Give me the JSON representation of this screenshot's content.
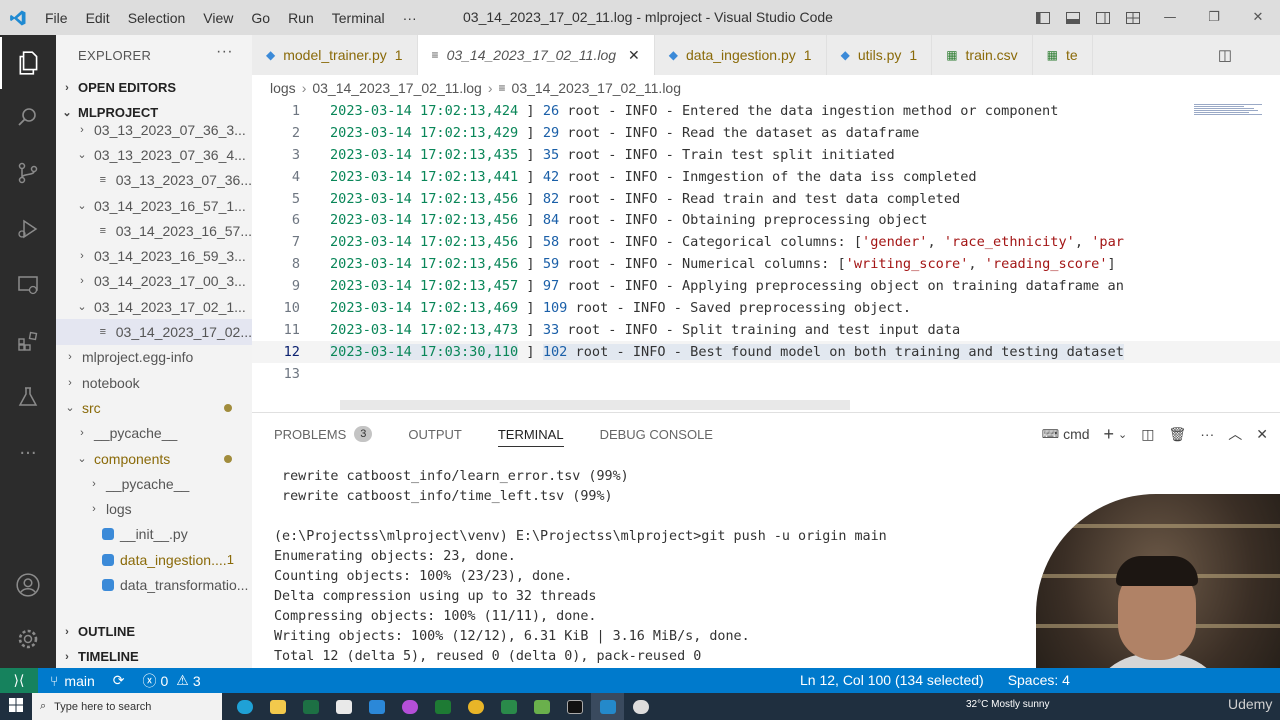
{
  "titlebar": {
    "menu": [
      "File",
      "Edit",
      "Selection",
      "View",
      "Go",
      "Run",
      "Terminal",
      "···"
    ],
    "window_title": "03_14_2023_17_02_11.log - mlproject - Visual Studio Code"
  },
  "sidebar": {
    "header": "EXPLORER",
    "more": "···",
    "open_editors": "OPEN EDITORS",
    "project": "MLPROJECT",
    "tree": [
      {
        "label": "03_13_2023_07_36_3...",
        "type": "folder",
        "open": false,
        "indent": 1
      },
      {
        "label": "03_13_2023_07_36_4...",
        "type": "folder",
        "open": true,
        "indent": 1
      },
      {
        "label": "03_13_2023_07_36...",
        "type": "file",
        "indent": 2
      },
      {
        "label": "03_14_2023_16_57_1...",
        "type": "folder",
        "open": true,
        "indent": 1
      },
      {
        "label": "03_14_2023_16_57...",
        "type": "file",
        "indent": 2
      },
      {
        "label": "03_14_2023_16_59_3...",
        "type": "folder",
        "open": false,
        "indent": 1
      },
      {
        "label": "03_14_2023_17_00_3...",
        "type": "folder",
        "open": false,
        "indent": 1
      },
      {
        "label": "03_14_2023_17_02_1...",
        "type": "folder",
        "open": true,
        "indent": 1
      },
      {
        "label": "03_14_2023_17_02...",
        "type": "file",
        "indent": 2,
        "selected": true
      },
      {
        "label": "mlproject.egg-info",
        "type": "folder",
        "open": false,
        "indent": 0
      },
      {
        "label": "notebook",
        "type": "folder",
        "open": false,
        "indent": 0
      },
      {
        "label": "src",
        "type": "folder",
        "open": true,
        "indent": 0,
        "modified": true,
        "dot": true
      },
      {
        "label": "__pycache__",
        "type": "folder",
        "open": false,
        "indent": 1
      },
      {
        "label": "components",
        "type": "folder",
        "open": true,
        "indent": 1,
        "modified": true,
        "dot": true
      },
      {
        "label": "__pycache__",
        "type": "folder",
        "open": false,
        "indent": 2
      },
      {
        "label": "logs",
        "type": "folder",
        "open": false,
        "indent": 2
      },
      {
        "label": "__init__.py",
        "type": "py",
        "indent": 2
      },
      {
        "label": "data_ingestion....",
        "type": "py",
        "indent": 2,
        "modified": true,
        "badge": "1"
      },
      {
        "label": "data_transformatio...",
        "type": "py",
        "indent": 2
      }
    ],
    "outline": "OUTLINE",
    "timeline": "TIMELINE"
  },
  "tabs": [
    {
      "label": "model_trainer.py",
      "badge": "1",
      "icon": "python-icon"
    },
    {
      "label": "03_14_2023_17_02_11.log",
      "badge": "",
      "icon": "lines-icon",
      "active": true
    },
    {
      "label": "data_ingestion.py",
      "badge": "1",
      "icon": "python-icon"
    },
    {
      "label": "utils.py",
      "badge": "1",
      "icon": "python-icon"
    },
    {
      "label": "train.csv",
      "badge": "",
      "icon": "table-icon"
    },
    {
      "label": "te",
      "badge": "",
      "icon": "table-icon"
    }
  ],
  "breadcrumb": [
    "logs",
    "03_14_2023_17_02_11.log",
    "03_14_2023_17_02_11.log"
  ],
  "editor": {
    "lines": [
      {
        "n": "1",
        "ts": "2023-03-14 17:02:13,424",
        "num": "26",
        "msg": " root - INFO - Entered the data ingestion method or component"
      },
      {
        "n": "2",
        "ts": "2023-03-14 17:02:13,429",
        "num": "29",
        "msg": " root - INFO - Read the dataset as dataframe"
      },
      {
        "n": "3",
        "ts": "2023-03-14 17:02:13,435",
        "num": "35",
        "msg": " root - INFO - Train test split initiated"
      },
      {
        "n": "4",
        "ts": "2023-03-14 17:02:13,441",
        "num": "42",
        "msg": " root - INFO - Inmgestion of the data iss completed"
      },
      {
        "n": "5",
        "ts": "2023-03-14 17:02:13,456",
        "num": "82",
        "msg": " root - INFO - Read train and test data completed"
      },
      {
        "n": "6",
        "ts": "2023-03-14 17:02:13,456",
        "num": "84",
        "msg": " root - INFO - Obtaining preprocessing object"
      },
      {
        "n": "7",
        "ts": "2023-03-14 17:02:13,456",
        "num": "58",
        "msg": " root - INFO - Categorical columns: [",
        "strs": [
          "'gender'",
          ", ",
          "'race_ethnicity'",
          ", ",
          "'par"
        ]
      },
      {
        "n": "8",
        "ts": "2023-03-14 17:02:13,456",
        "num": "59",
        "msg": " root - INFO - Numerical columns: [",
        "strs": [
          "'writing_score'",
          ", ",
          "'reading_score'",
          "]"
        ]
      },
      {
        "n": "9",
        "ts": "2023-03-14 17:02:13,457",
        "num": "97",
        "msg": " root - INFO - Applying preprocessing object on training dataframe an"
      },
      {
        "n": "10",
        "ts": "2023-03-14 17:02:13,469",
        "num": "109",
        "msg": " root - INFO - Saved preprocessing object."
      },
      {
        "n": "11",
        "ts": "2023-03-14 17:02:13,473",
        "num": "33",
        "msg": " root - INFO - Split training and test input data"
      },
      {
        "n": "12",
        "ts": "2023-03-14 17:03:30,110",
        "num": "102",
        "msg": " root - INFO - Best found model on both training and testing dataset",
        "current": true
      },
      {
        "n": "13",
        "ts": "",
        "num": "",
        "msg": ""
      }
    ]
  },
  "panel": {
    "tabs": [
      "PROBLEMS",
      "OUTPUT",
      "TERMINAL",
      "DEBUG CONSOLE"
    ],
    "problems_count": "3",
    "active_tab": "TERMINAL",
    "shell": "cmd",
    "terminal_lines": [
      " rewrite catboost_info/learn_error.tsv (99%)",
      " rewrite catboost_info/time_left.tsv (99%)",
      "",
      "(e:\\Projectss\\mlproject\\venv) E:\\Projectss\\mlproject>git push -u origin main",
      "Enumerating objects: 23, done.",
      "Counting objects: 100% (23/23), done.",
      "Delta compression using up to 32 threads",
      "Compressing objects: 100% (11/11), done.",
      "Writing objects: 100% (12/12), 6.31 KiB | 3.16 MiB/s, done.",
      "Total 12 (delta 5), reused 0 (delta 0), pack-reused 0"
    ]
  },
  "statusbar": {
    "branch": "main",
    "errors": "0",
    "warnings": "3",
    "position": "Ln 12, Col 100 (134 selected)",
    "spaces": "Spaces: 4"
  },
  "taskbar": {
    "search_placeholder": "Type here to search",
    "weather": "32°C  Mostly sunny",
    "watermark": "Udemy"
  },
  "colors": {
    "statusbar": "#007acc",
    "activitybar": "#2c2c2c",
    "timestamp": "#098658",
    "string": "#a31515"
  }
}
